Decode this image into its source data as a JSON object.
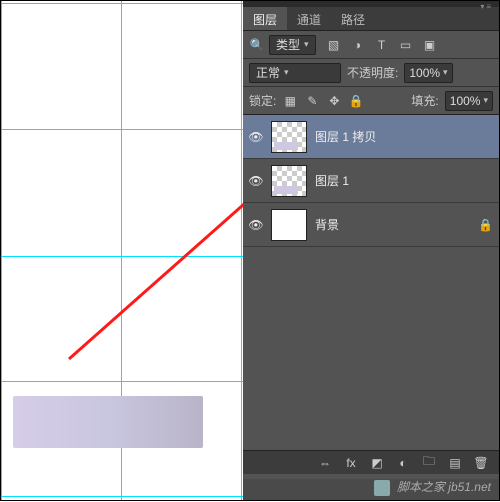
{
  "tabs": {
    "layers": "图层",
    "channels": "通道",
    "paths": "路径"
  },
  "filter": {
    "kind": "类型"
  },
  "blend": {
    "mode": "正常",
    "opacity_label": "不透明度:",
    "opacity_value": "100%"
  },
  "lock": {
    "label": "锁定:",
    "fill_label": "填充:",
    "fill_value": "100%"
  },
  "layers": {
    "items": [
      {
        "name": "图层 1 拷贝"
      },
      {
        "name": "图层 1"
      },
      {
        "name": "背景"
      }
    ]
  },
  "watermark": "脚本之家 jb51.net"
}
